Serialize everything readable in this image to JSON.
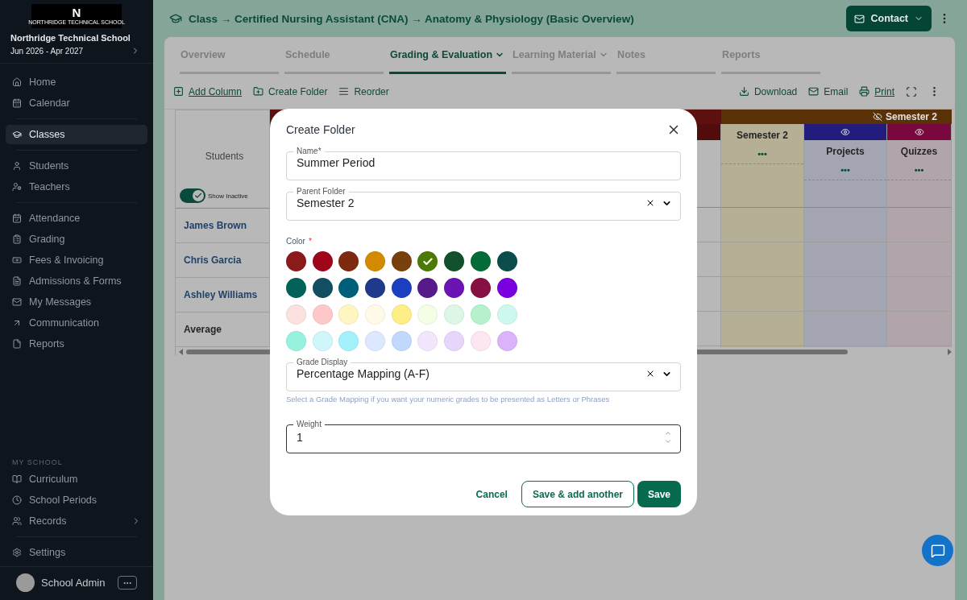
{
  "sidebar": {
    "logo": {
      "mark": "N",
      "text": "NORTHRIDGE TECHNICAL SCHOOL"
    },
    "school_name": "Northridge Technical School",
    "period": "Jun 2026 - Apr 2027",
    "nav_groups": [
      {
        "items": [
          {
            "label": "Home",
            "selected": false
          },
          {
            "label": "Calendar",
            "selected": false
          }
        ]
      },
      {
        "items": [
          {
            "label": "Classes",
            "selected": true
          }
        ]
      },
      {
        "items": [
          {
            "label": "Students",
            "selected": false
          },
          {
            "label": "Teachers",
            "selected": false
          }
        ]
      },
      {
        "items": [
          {
            "label": "Attendance",
            "selected": false
          },
          {
            "label": "Grading",
            "selected": false
          },
          {
            "label": "Fees & Invoicing",
            "selected": false
          },
          {
            "label": "Admissions & Forms",
            "selected": false
          },
          {
            "label": "My Messages",
            "selected": false
          },
          {
            "label": "Communication",
            "selected": false
          },
          {
            "label": "Reports",
            "selected": false
          }
        ]
      }
    ],
    "school_section": {
      "heading": "MY SCHOOL",
      "items": [
        {
          "label": "Curriculum",
          "selected": false,
          "expandable": false
        },
        {
          "label": "School Periods",
          "selected": false,
          "expandable": false
        },
        {
          "label": "Records",
          "selected": false,
          "expandable": true
        }
      ]
    },
    "settings": {
      "label": "Settings",
      "selected": false
    },
    "user": {
      "name": "School Admin"
    }
  },
  "header": {
    "breadcrumb": "Class → Certified Nursing Assistant (CNA) → Anatomy & Physiology (Basic Overview)",
    "contact_button": "Contact"
  },
  "tabs": [
    {
      "label": "Overview",
      "selected": false,
      "dropdown": false
    },
    {
      "label": "Schedule",
      "selected": false,
      "dropdown": false
    },
    {
      "label": "Grading & Evaluation",
      "selected": true,
      "dropdown": true
    },
    {
      "label": "Learning Material",
      "selected": false,
      "dropdown": true
    },
    {
      "label": "Notes",
      "selected": false,
      "dropdown": false
    },
    {
      "label": "Reports",
      "selected": false,
      "dropdown": false
    }
  ],
  "toolbar": {
    "left": [
      {
        "label": "Add Column",
        "underlined": true
      },
      {
        "label": "Create Folder",
        "underlined": false
      },
      {
        "label": "Reorder",
        "underlined": false
      }
    ],
    "right": [
      {
        "label": "Download",
        "underlined": false
      },
      {
        "label": "Email",
        "underlined": false
      },
      {
        "label": "Print",
        "underlined": true
      }
    ]
  },
  "table": {
    "header_label": "Students",
    "show_inactive": {
      "label": "Show Inactive",
      "on": true
    },
    "groups": [
      {
        "color": "#5c1010",
        "columns": [
          {
            "kind": "hidden",
            "color": "#530c0c"
          }
        ]
      },
      {
        "name": "Semester 2",
        "color": "#5a3106",
        "columns": [
          {
            "kind": "folder",
            "name": "Semester 2",
            "color": "#b4af95"
          },
          {
            "kind": "category",
            "name": "Projects",
            "color": "#221c7c"
          },
          {
            "kind": "category",
            "name": "Quizzes",
            "color": "#78083e"
          }
        ]
      }
    ],
    "column_menu": "•••",
    "rows": [
      {
        "kind": "student",
        "name": "James Brown"
      },
      {
        "kind": "student",
        "name": "Chris Garcia"
      },
      {
        "kind": "student",
        "name": "Ashley Williams"
      },
      {
        "kind": "summary",
        "name": "Average"
      }
    ]
  },
  "dialog": {
    "title": "Create Folder",
    "name_field": {
      "label": "Name*",
      "value": "Summer Period"
    },
    "parent_field": {
      "label": "Parent Folder",
      "value": "Semester 2"
    },
    "color_label": "Color",
    "required_mark": "*",
    "colors": [
      {
        "color": "#8b1a1a",
        "selected": false
      },
      {
        "color": "#a0061a",
        "selected": false
      },
      {
        "color": "#7d2a0e",
        "selected": false
      },
      {
        "color": "#d38a00",
        "selected": false
      },
      {
        "color": "#77400c",
        "selected": false
      },
      {
        "color": "#4b7a06",
        "selected": true
      },
      {
        "color": "#12512c",
        "selected": false
      },
      {
        "color": "#036b35",
        "selected": false
      },
      {
        "color": "#0b4d4a",
        "selected": false
      },
      {
        "color": "#006259",
        "selected": false
      },
      {
        "color": "#134f63",
        "selected": false
      },
      {
        "color": "#005f78",
        "selected": false
      },
      {
        "color": "#1f3a8a",
        "selected": false
      },
      {
        "color": "#1b3fbf",
        "selected": false
      },
      {
        "color": "#561a8a",
        "selected": false
      },
      {
        "color": "#6b14b3",
        "selected": false
      },
      {
        "color": "#871042",
        "selected": false
      },
      {
        "color": "#7a00e0",
        "selected": false
      },
      {
        "color": "#fde0e0",
        "selected": false
      },
      {
        "color": "#fec8c8",
        "selected": false
      },
      {
        "color": "#fff5c0",
        "selected": false
      },
      {
        "color": "#fffae8",
        "selected": false
      },
      {
        "color": "#fdee86",
        "selected": false
      },
      {
        "color": "#f4fde6",
        "selected": false
      },
      {
        "color": "#dcf7e6",
        "selected": false
      },
      {
        "color": "#b5f2cc",
        "selected": false
      },
      {
        "color": "#cef8ef",
        "selected": false
      },
      {
        "color": "#95f2de",
        "selected": false
      },
      {
        "color": "#cff6fb",
        "selected": false
      },
      {
        "color": "#a3f1fa",
        "selected": false
      },
      {
        "color": "#dce8fd",
        "selected": false
      },
      {
        "color": "#c0d9fd",
        "selected": false
      },
      {
        "color": "#f1e6fc",
        "selected": false
      },
      {
        "color": "#e6d6fc",
        "selected": false
      },
      {
        "color": "#fbe6f2",
        "selected": false
      },
      {
        "color": "#dab3fb",
        "selected": false
      }
    ],
    "grade_field": {
      "label": "Grade Display",
      "value": "Percentage Mapping (A-F)",
      "helper": "Select a Grade Mapping if you want your numeric grades to be presented as Letters or Phrases"
    },
    "weight_field": {
      "label": "Weight",
      "value": "1",
      "focused": true
    },
    "buttons": [
      {
        "kind": "text",
        "label": "Cancel"
      },
      {
        "kind": "outline",
        "label": "Save & add another"
      },
      {
        "kind": "primary",
        "label": "Save"
      }
    ]
  }
}
